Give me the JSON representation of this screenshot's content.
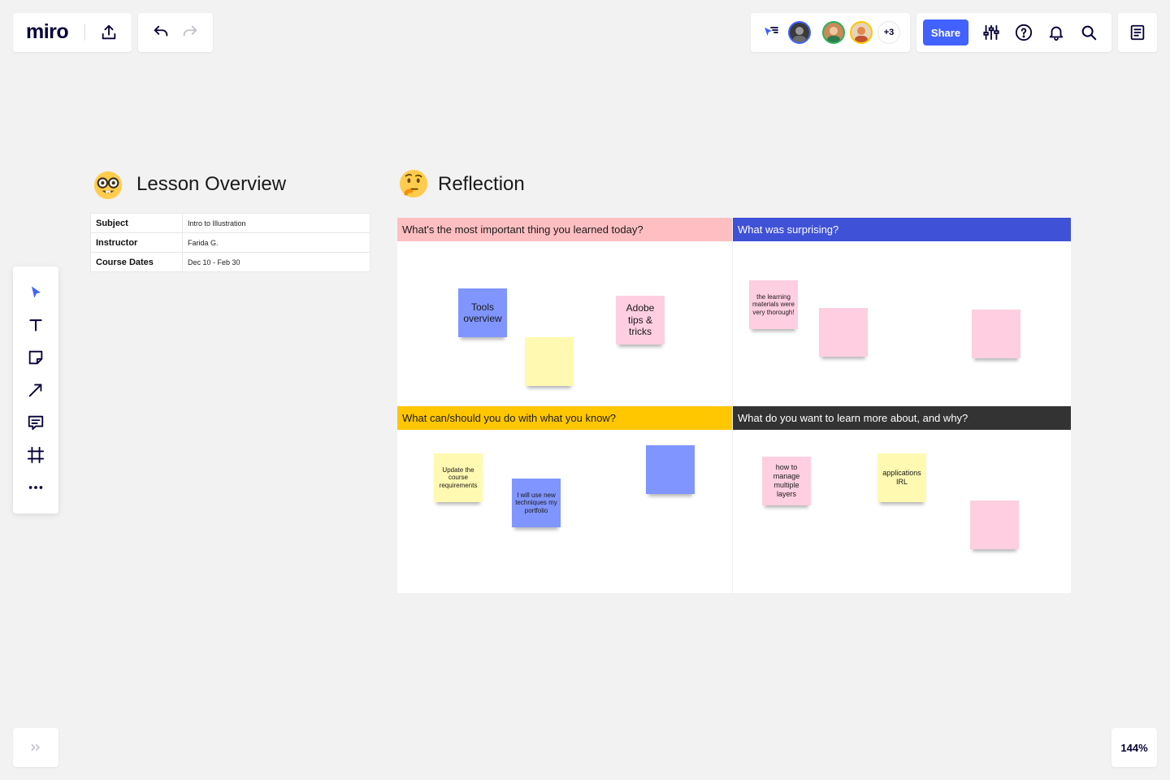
{
  "app": {
    "logo": "miro"
  },
  "collaborators": {
    "more_count": "+3"
  },
  "header": {
    "share_label": "Share"
  },
  "zoom": {
    "level": "144%"
  },
  "lesson_overview": {
    "title": "Lesson Overview",
    "rows": [
      {
        "label": "Subject",
        "value": "Intro to Illustration"
      },
      {
        "label": "Instructor",
        "value": "Farida G."
      },
      {
        "label": "Course Dates",
        "value": "Dec 10 - Feb 30"
      }
    ]
  },
  "reflection": {
    "title": "Reflection",
    "quadrants": [
      {
        "header": "What's the most important thing you learned today?",
        "header_bg": "#ffbfc2",
        "header_color": "#1a1a1a",
        "stickies": [
          {
            "text": "Tools overview",
            "color": "blue"
          },
          {
            "text": "",
            "color": "yellow"
          },
          {
            "text": "Adobe tips & tricks",
            "color": "pink"
          }
        ]
      },
      {
        "header": "What was surprising?",
        "header_bg": "#3f51d6",
        "header_color": "#ffffff",
        "stickies": [
          {
            "text": "the learning materials were very thorough!",
            "color": "pink"
          },
          {
            "text": "",
            "color": "pink"
          },
          {
            "text": "",
            "color": "pink"
          }
        ]
      },
      {
        "header": "What can/should you do with what you know?",
        "header_bg": "#ffc700",
        "header_color": "#1a1a1a",
        "stickies": [
          {
            "text": "Update the course requirements",
            "color": "yellow"
          },
          {
            "text": "I will use new techniques my portfolio",
            "color": "blue"
          },
          {
            "text": "",
            "color": "blue"
          }
        ]
      },
      {
        "header": "What do you want to learn more about, and why?",
        "header_bg": "#333333",
        "header_color": "#ffffff",
        "stickies": [
          {
            "text": "how to manage multiple layers",
            "color": "pink"
          },
          {
            "text": "applications IRL",
            "color": "yellow"
          },
          {
            "text": "",
            "color": "pink"
          }
        ]
      }
    ]
  },
  "colors": {
    "accent": "#4262ff",
    "sticky_blue": "#8095ff",
    "sticky_yellow": "#fff9b1",
    "sticky_pink": "#ffcee0"
  },
  "icons": [
    "export-icon",
    "undo-icon",
    "redo-icon",
    "cursor-tracking-icon",
    "settings-sliders-icon",
    "help-icon",
    "bell-icon",
    "search-icon",
    "notes-icon",
    "select-arrow-icon",
    "text-icon",
    "sticky-note-icon",
    "line-arrow-icon",
    "comment-icon",
    "frame-icon",
    "more-icon",
    "expand-chevrons-icon",
    "nerd-face-emoji",
    "thinking-face-emoji"
  ]
}
